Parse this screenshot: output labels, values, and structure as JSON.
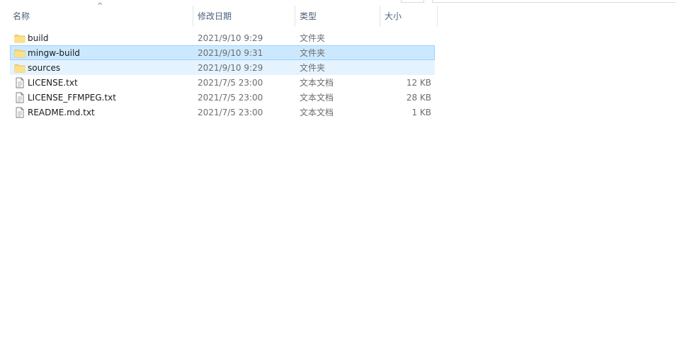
{
  "columns": {
    "name": "名称",
    "date": "修改日期",
    "type": "类型",
    "size": "大小"
  },
  "sort_indicator": "^",
  "files": [
    {
      "name": "build",
      "date": "2021/9/10 9:29",
      "type": "文件夹",
      "size": "",
      "icon": "folder-icon",
      "state": "normal"
    },
    {
      "name": "mingw-build",
      "date": "2021/9/10 9:31",
      "type": "文件夹",
      "size": "",
      "icon": "folder-icon",
      "state": "selected"
    },
    {
      "name": "sources",
      "date": "2021/9/10 9:29",
      "type": "文件夹",
      "size": "",
      "icon": "folder-icon",
      "state": "hover"
    },
    {
      "name": "LICENSE.txt",
      "date": "2021/7/5 23:00",
      "type": "文本文档",
      "size": "12 KB",
      "icon": "text-file-icon",
      "state": "normal"
    },
    {
      "name": "LICENSE_FFMPEG.txt",
      "date": "2021/7/5 23:00",
      "type": "文本文档",
      "size": "28 KB",
      "icon": "text-file-icon",
      "state": "normal"
    },
    {
      "name": "README.md.txt",
      "date": "2021/7/5 23:00",
      "type": "文本文档",
      "size": "1 KB",
      "icon": "text-file-icon",
      "state": "normal"
    }
  ],
  "colors": {
    "selected_bg": "#cce8ff",
    "selected_border": "#99d1ff",
    "hover_bg": "#e5f3ff",
    "folder": "#f8d775",
    "header_text": "#4c607a"
  }
}
